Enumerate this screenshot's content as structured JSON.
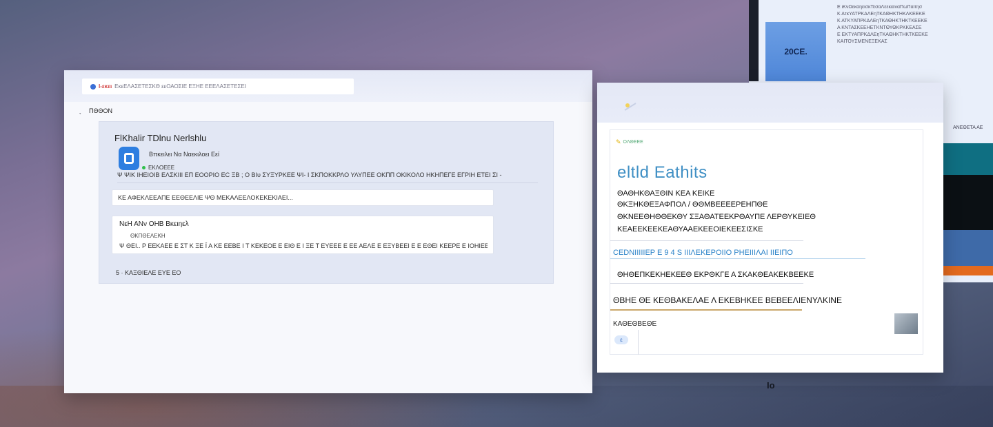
{
  "far_panel": {
    "tile_label": "20CE.",
    "text_lines": [
      "Ε ιΚνΩεκαηεισκΤεσαΛεεκαιναΠωΠαιτησ",
      "Κ ΑτκΥΑΤΡΚΔΛΕηΤΚΑΘΗΚΤΗΚΛΚΕΕΚΕ",
      "Κ ΑΤΚΥΑΠΡΚΔΛΕηΤΚΑΘΗΚΤΗΚΤΚΕΕΚΕ",
      "Α ΚΝΤΑΣΚΕΕΗΕΤΚΝΤΘΥΘΚΡΚΚΕΑΣΕ",
      "Ε ΕΚΤΥΑΠΡΚΔΛΕηΤΚΑΘΗΚΤΗΚΤΚΕΕΚΕ",
      "ΚΑΙΤΟΥΣΜΕΝΕΞΕΚΑΣ"
    ],
    "caption": "ΑΝΕΘΕΤΑ ΑΕ"
  },
  "main_window": {
    "address_bar": {
      "site_name": "Ι-εκει",
      "url_text": "ΕκεΕΛΑΣΕΤΕΣΚΘ εεΟΑΟΣΙΕ ΕΞΗΕ ΕΕΕΛΑΣΕΤΕΣΕΙ"
    },
    "breadcrumb": {
      "back": "ׇ",
      "current": "ΠΘΘΟΝ"
    },
    "compose": {
      "title": "FlKhalir TDlnu Nerlshlu",
      "subtitle": "Βπκειλει Να Ναεκιλοει Εεί",
      "status": "ΕΚΛΟΕΕΕ",
      "row_text": "Ψ ΨΙΚ  ΙΗΕΙΟΙΒ ΕΛΣΚΙΙΙ ΕΠ ΕΟΟΡΙΟ ΕC ΞΒ ; Ο ΒΙυ ΣΥΞΥΡΚΕΕ ΨΙ- Ι ΣΚΠΟΚΚΡΛΟ ΥΛΥΠΕΕ ΟΚΠΠ ΟΚΙΚΟΛΟ ΗΚΗΠΕΓΕ ΕΓΡΙΗ ΕΤΕΙ ΣΙ -"
    },
    "input_value": "ΚΕ ΑΦΕΚΛΕΕΑΠΕ ΕΕΘΕΕΛΙΕ ΨΘ ΜΕΚΑΛΕΕΛΟΚΕΚΕΚΙΑΕΙ...",
    "message": {
      "title": "ΝεΗ ΑΝν ΟΗΒ Βκειηελ",
      "subtitle": "ΘΚΠΘΕΛΕΚΗ",
      "body": "Ψ ΘΕΙ.. Ρ ΕΕΚΑΕΕ Ε ΣΤ Κ ΞΕ Ϊ Α ΚΕ ΕΕΒΕ Ι Τ ΚΕΚΕΟΕ Ε ΕΙΘ Ε Ι ΞΕ Τ ΕΥΕΕΕ Ε ΕΕ ΑΕΛΕ Ε ΕΞΥΒΕΕΙ Ε Ε ΕΘΕΙ ΚΕΕΡΕ Ε ΙΟΗΙΕΕ."
    },
    "footer": "5 · ΚΑΞΘΙΕΛΕ ΕΥΕ ΕΟ"
  },
  "right_window": {
    "head": "ΟΛΘΕΕΕ",
    "title": "eltld  Eathits",
    "lines": [
      "ΘΑΘΗΚΘΑΞΘΙΝ ΚΕΑ ΚΕΙΚΕ",
      "ΘΚΞΗΚΘΕΞΑΦΠΟΛ / ΘΘΜΒΕΕΕΕΡΕΗΠΘΕ",
      "ΚΕΑΕΕΚΕΕΚΕΑΘΥΑΑΕΚΕΕΟΙΕΚΕΕΣΙΣΚΕ"
    ],
    "line3_prefix": "ΘΚΝΕΕΘΗΘΘΕΚΘΥ ΣΞΑΘΑΤΕΕΚΡΘΑΥΠΕ ΛΕΡΘΥΚΕΙΕΘ",
    "link": "CEDNΙΙΙΙΙΕΡ Ε 9 4  S ΙΙΙΛΕΚΕΡΟΙΙΟ  ΡΗΕΙΙΙΛΑΙ   ΙΙΕΙΠΟ",
    "line4": "ΘΗΘΕΠΚΕΚΗΕΚΕΕΘ ΕΚΡΘΚΓΕ Α ΣΚΑΚΘΕΑΚΕΚΒΕΕΚΕ",
    "strong": "ΘΒΗΕ ΘΕ ΚΕΘΒΑΚΕΛΑΕ Λ ΕΚΕΒΗΚΕΕ ΒΕΒΕΕΛΙΕΝΥΛΚΙΝΕ",
    "small": "ΚΑΘΕΘΒΕΘΕ",
    "pill": "ε"
  },
  "bottom_tag": "Ιο"
}
